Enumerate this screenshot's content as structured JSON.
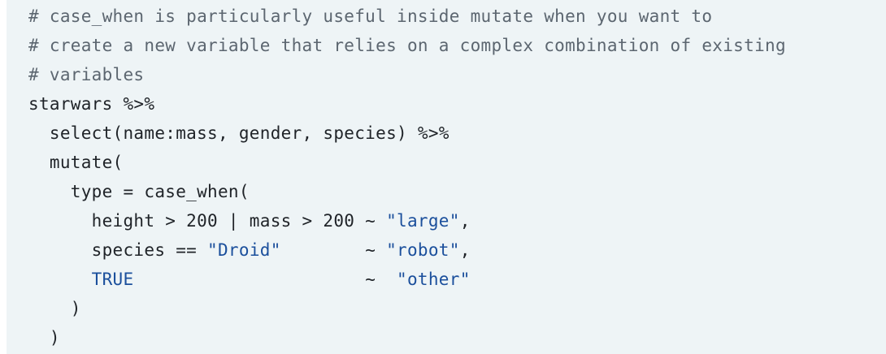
{
  "code": {
    "lines": [
      [
        {
          "text": "# case_when is particularly useful inside mutate when you want to",
          "kind": "comment"
        }
      ],
      [
        {
          "text": "# create a new variable that relies on a complex combination of existing",
          "kind": "comment"
        }
      ],
      [
        {
          "text": "# variables",
          "kind": "comment"
        }
      ],
      [
        {
          "text": "starwars %>%",
          "kind": "plain"
        }
      ],
      [
        {
          "text": "  select(name:mass, gender, species) %>%",
          "kind": "plain"
        }
      ],
      [
        {
          "text": "  mutate(",
          "kind": "plain"
        }
      ],
      [
        {
          "text": "    type = case_when(",
          "kind": "plain"
        }
      ],
      [
        {
          "text": "      height > 200 | mass > 200 ~ ",
          "kind": "plain"
        },
        {
          "text": "\"large\"",
          "kind": "string"
        },
        {
          "text": ",",
          "kind": "plain"
        }
      ],
      [
        {
          "text": "      species == ",
          "kind": "plain"
        },
        {
          "text": "\"Droid\"",
          "kind": "string"
        },
        {
          "text": "        ~ ",
          "kind": "plain"
        },
        {
          "text": "\"robot\"",
          "kind": "string"
        },
        {
          "text": ",",
          "kind": "plain"
        }
      ],
      [
        {
          "text": "      ",
          "kind": "plain"
        },
        {
          "text": "TRUE",
          "kind": "const"
        },
        {
          "text": "                      ~  ",
          "kind": "plain"
        },
        {
          "text": "\"other\"",
          "kind": "string"
        }
      ],
      [
        {
          "text": "    )",
          "kind": "plain"
        }
      ],
      [
        {
          "text": "  )",
          "kind": "plain"
        }
      ]
    ]
  }
}
